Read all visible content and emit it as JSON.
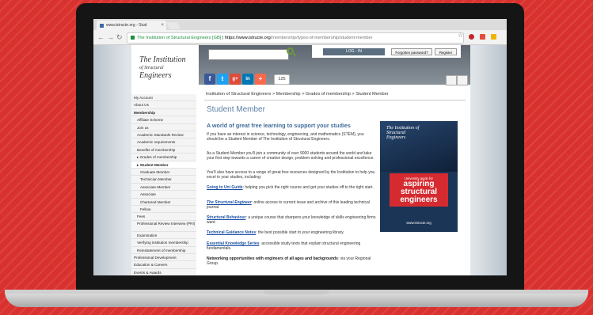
{
  "browser": {
    "tab_title": "www.istructe.org - Stud",
    "secure_label": "The Institution of Structural Engineers [GB]",
    "url_host": "https://www.istructe.org",
    "url_path": "/membership/types-of-membership/student-member"
  },
  "header": {
    "logo_line1": "The Institution",
    "logo_line2": "of Structural",
    "logo_line3": "Engineers",
    "login_label": "LOG - IN",
    "forgotten_label": "Forgotten password?",
    "register_label": "Register",
    "share_count": "125"
  },
  "sidebar": {
    "items": [
      {
        "label": "My Account"
      },
      {
        "label": "About Us"
      },
      {
        "label": "Membership"
      },
      {
        "label": "Affiliate Scheme"
      },
      {
        "label": "Join us"
      },
      {
        "label": "Academic Standards Review"
      },
      {
        "label": "Academic requirements"
      },
      {
        "label": "Benefits of membership"
      },
      {
        "label": "▸ Grades of membership"
      },
      {
        "label": "▸ Student Member"
      },
      {
        "label": "Graduate Member"
      },
      {
        "label": "Technician Member"
      },
      {
        "label": "Associate-Member"
      },
      {
        "label": "Associate"
      },
      {
        "label": "Chartered Member"
      },
      {
        "label": "Fellow"
      },
      {
        "label": "Fees"
      },
      {
        "label": "Professional Review Interview (PRI)"
      },
      {
        "label": "Examination"
      },
      {
        "label": "Verifying institution membership"
      },
      {
        "label": "Reinstatement of membership"
      },
      {
        "label": "Professional Development"
      },
      {
        "label": "Education & Careers"
      },
      {
        "label": "Events & Awards"
      }
    ]
  },
  "content": {
    "breadcrumb": "Institution of Structural Engineers > Membership > Grades of membership > Student Member",
    "title": "Student Member",
    "subtitle": "A world of great free learning to support your studies",
    "p1": "If you have an interest in science, technology, engineering, and mathematics (STEM), you should be a Student Member of The Institution of Structural Engineers.",
    "p2": "As a Student Member you'll join a community of over 9000 students around the world and take your first step towards a career of creative design, problem-solving and professional excellence.",
    "p3": "You'll also have access to a range of great free resources designed by the Institution to help you excel in your studies, including:",
    "l1_link": "Going to Uni Guide",
    "l1_text": ": helping you pick the right course and get your studies off to the right start.",
    "l2_link": "The Structural Engineer",
    "l2_text": ": online access to current issue and archive of this leading technical journal.",
    "l3_link": "Structural Behaviour",
    "l3_text": ": a unique course that sharpens your knowledge of skills engineering firms want.",
    "l4_link": "Technical Guidance Notes",
    "l4_text": ": the best possible start to your engineering library.",
    "l5_link": "Essential Knowledge Series",
    "l5_text": ": accessible study texts that explain structural engineering fundamentals.",
    "networking_bold": "Networking opportunities with engineers of all ages and backgrounds",
    "networking_text": ": via your Regional Group."
  },
  "cover": {
    "logo": "The Institution of Structural Engineers",
    "guide_label": "University guide for",
    "line1": "aspiring",
    "line2": "structural",
    "line3": "engineers",
    "url": "www.istructe.org"
  },
  "colors": {
    "background": "#d9322e",
    "facebook": "#3b5998",
    "twitter": "#1da1f2",
    "googleplus": "#dd4b39",
    "linkedin": "#0077b5",
    "addthis": "#f8694d"
  }
}
